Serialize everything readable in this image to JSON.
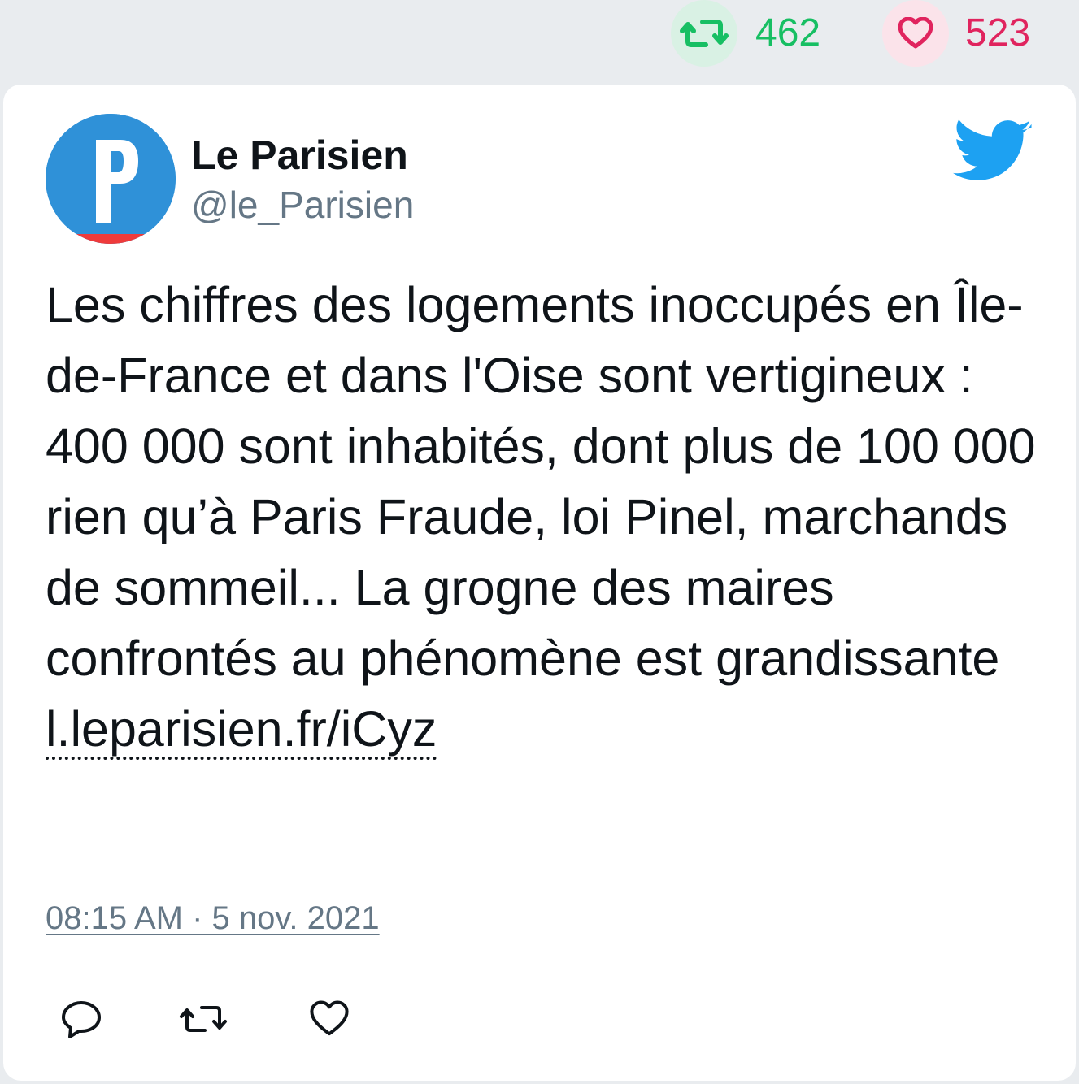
{
  "stats": {
    "retweet_count": "462",
    "like_count": "523",
    "retweet_icon": "retweet-icon",
    "like_icon": "heart-icon",
    "retweet_color": "#17bf63",
    "like_color": "#e0245e"
  },
  "author": {
    "name": "Le Parisien",
    "handle": "@le_Parisien",
    "avatar_letter": "P",
    "avatar_color": "#2f91d8"
  },
  "tweet": {
    "text": "Les chiffres des logements inoccupés en Île-de-France et dans l'Oise sont vertigineux : 400 000 sont inhabités, dont plus de 100 000 rien qu’à Paris Fraude, loi Pinel, marchands de sommeil... La grogne des maires confrontés au phénomène est grandissante",
    "link": "l.leparisien.fr/iCyz",
    "timestamp": "08:15 AM · 5 nov. 2021"
  },
  "brand": {
    "icon": "twitter-bird-icon",
    "color": "#1da1f2"
  },
  "actions": [
    {
      "icon": "reply-icon"
    },
    {
      "icon": "retweet-icon"
    },
    {
      "icon": "heart-icon"
    }
  ]
}
